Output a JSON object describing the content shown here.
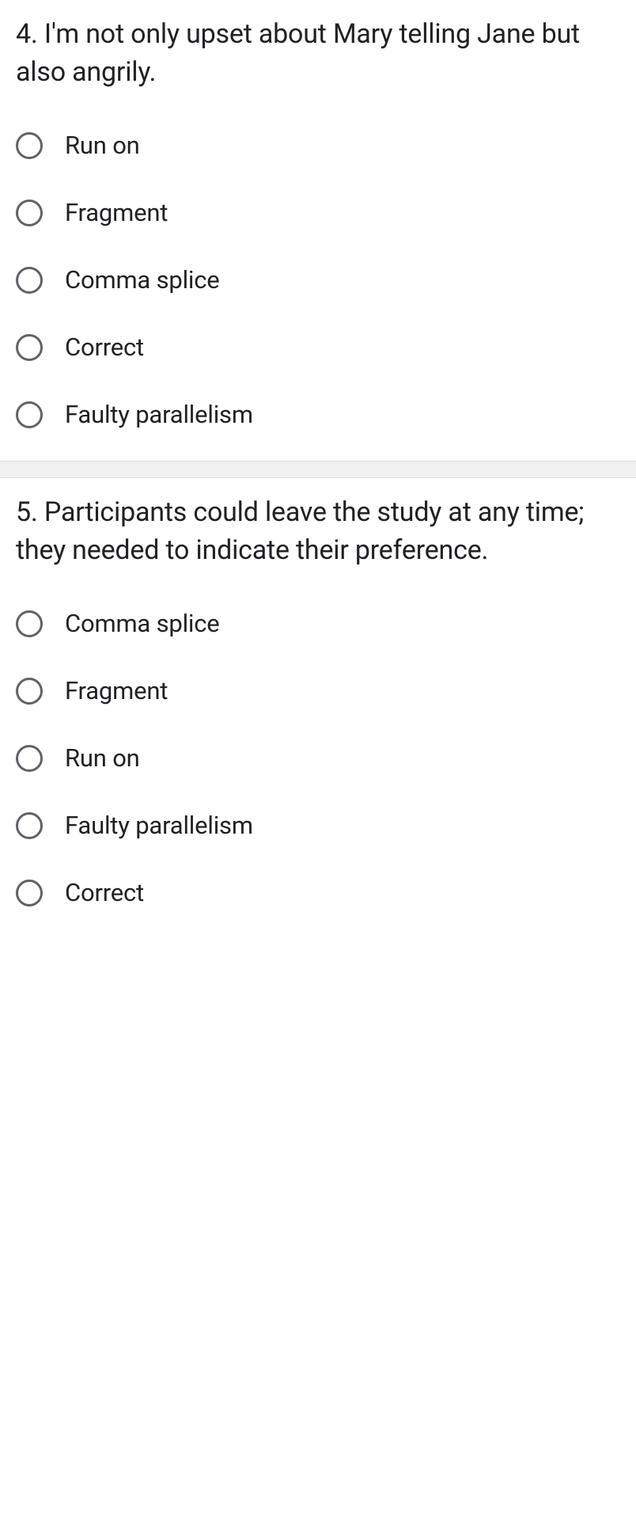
{
  "questions": [
    {
      "text": "4. I'm not only upset about Mary telling Jane but also angrily.",
      "options": [
        "Run on",
        "Fragment",
        "Comma splice",
        "Correct",
        "Faulty parallelism"
      ]
    },
    {
      "text": "5. Participants could leave the study at any time; they needed to indicate their preference.",
      "options": [
        "Comma splice",
        "Fragment",
        "Run on",
        "Faulty parallelism",
        "Correct"
      ]
    }
  ]
}
